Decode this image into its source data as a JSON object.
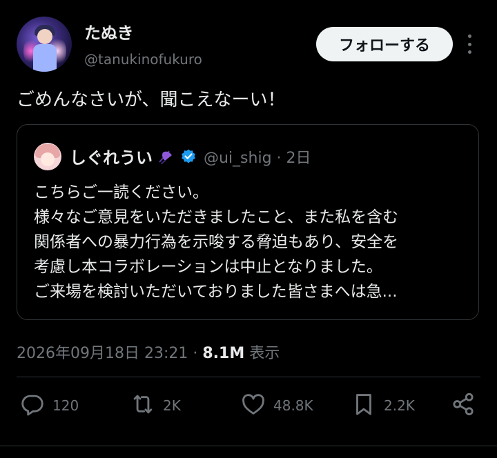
{
  "author": {
    "display_name": "たぬき",
    "handle": "@tanukinofukuro"
  },
  "follow_label": "フォローする",
  "tweet_text": "ごめんなさいが、聞こえなーい！",
  "quote": {
    "display_name": "しぐれうい",
    "handle_line": "@ui_shig · 2日",
    "lines": [
      "こちらご一読ください。",
      "様々なご意見をいただきましたこと、また私を含む",
      "関係者への暴力行為を示唆する脅迫もあり、安全を",
      "考慮し本コラボレーションは中止となりました。",
      "ご来場を検討いただいておりました皆さまへは急..."
    ]
  },
  "meta": {
    "timestamp": "2026年09月18日 23:21",
    "separator": " · ",
    "views_count": "8.1M",
    "views_label": " 表示"
  },
  "actions": {
    "reply_count": "120",
    "retweet_count": "2K",
    "like_count": "48.8K",
    "bookmark_count": "2.2K"
  },
  "icons": {
    "reply": "reply-icon",
    "retweet": "retweet-icon",
    "like": "heart-icon",
    "bookmark": "bookmark-icon",
    "share": "share-icon",
    "verified": "verified-badge-icon",
    "umbrella": "umbrella-icon",
    "more": "more-dots-icon"
  },
  "colors": {
    "background": "#000000",
    "text": "#e7e9ea",
    "secondary": "#71767b",
    "verified": "#1d9bf0",
    "umbrella": "#8e59d8"
  }
}
